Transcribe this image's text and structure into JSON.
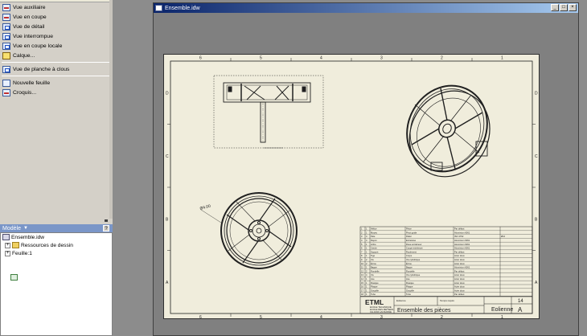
{
  "tools": [
    {
      "label": "Vue auxiliaire",
      "icon": "auxiliary-view-icon"
    },
    {
      "label": "Vue en coupe",
      "icon": "section-view-icon"
    },
    {
      "label": "Vue de détail",
      "icon": "detail-view-icon"
    },
    {
      "label": "Vue interrompue",
      "icon": "broken-view-icon"
    },
    {
      "label": "Vue en coupe locale",
      "icon": "local-section-icon"
    },
    {
      "label": "Calque...",
      "icon": "overlay-icon"
    },
    {
      "label": "Vue de planche à clous",
      "icon": "nailboard-view-icon"
    },
    {
      "label": "Nouvelle feuille",
      "icon": "new-sheet-icon"
    },
    {
      "label": "Croquis...",
      "icon": "sketch-icon"
    }
  ],
  "model_panel": {
    "title": "Modèle",
    "help": "?",
    "tree": [
      {
        "label": "Ensemble.idw",
        "icon": "drawing-icon",
        "expand": ""
      },
      {
        "label": "Ressources de dessin",
        "icon": "folder-icon",
        "expand": "+"
      },
      {
        "label": "Feuille:1",
        "icon": "sheet-icon",
        "expand": "+"
      }
    ]
  },
  "document": {
    "title": "Ensemble.idw",
    "buttons": {
      "minimize": "_",
      "maximize": "□",
      "close": "×"
    }
  },
  "sheet": {
    "col_labels": [
      "6",
      "5",
      "4",
      "3",
      "2",
      "1"
    ],
    "row_labels": [
      "D",
      "C",
      "B",
      "A"
    ],
    "dimension_label": "Ø4.00",
    "title_block": {
      "school_logo": "ETML",
      "school_lines": [
        "ECOLE TECHNIQUE",
        "ECOLE DES METIERS",
        "CH-1004 LAUSANNE"
      ],
      "drawing_title": "Ensemble des pièces",
      "project": "Eolienne",
      "revision": "A",
      "sheet_number": "14",
      "author_label": "Eolienne",
      "date_label": "Temps requis"
    },
    "bom": [
      [
        "1",
        "1",
        "Hélice",
        "Pièce",
        "Par défaut",
        ""
      ],
      [
        "2",
        "1",
        "Moyeu",
        "Pivot guide",
        "Aluminium 6061",
        ""
      ],
      [
        "3",
        "4",
        "Pale",
        "Palier",
        "ISO 4762",
        "Ø10"
      ],
      [
        "4",
        "4",
        "Rayon",
        "Entretoise",
        "Aluminium 6061",
        ""
      ],
      [
        "5",
        "1",
        "Arbre",
        "Roue entraîneur",
        "Aluminium 6061",
        ""
      ],
      [
        "6",
        "1",
        "Cercle",
        "Coupe extérieure",
        "Aluminium 6061",
        ""
      ],
      [
        "7",
        "1",
        "Support",
        "Roulement",
        "Par défaut",
        ""
      ],
      [
        "8",
        "1",
        "Tige",
        "Corps",
        "Acier doux",
        ""
      ],
      [
        "9",
        "2",
        "Vis",
        "Vis cylindrique",
        "Acier doux",
        ""
      ],
      [
        "10",
        "2",
        "Écrou",
        "Écrou",
        "Acier doux",
        ""
      ],
      [
        "11",
        "1",
        "Bague",
        "Bague",
        "Aluminium 6061",
        ""
      ],
      [
        "12",
        "2",
        "Rondelle",
        "Rondelle",
        "Par défaut",
        ""
      ],
      [
        "13",
        "4",
        "Vis",
        "Vis cylindrique",
        "Acier doux",
        ""
      ],
      [
        "14",
        "1",
        "Axe",
        "Axe",
        "Acier doux",
        ""
      ],
      [
        "15",
        "1",
        "Flasque",
        "Flasque",
        "Acier doux",
        ""
      ],
      [
        "16",
        "1",
        "Plaque",
        "Plaque",
        "Acier doux",
        ""
      ],
      [
        "17",
        "1",
        "Goupille",
        "Goupille",
        "Acier doux",
        ""
      ],
      [
        "18",
        "1",
        "Tube",
        "Tube",
        "Par défaut",
        ""
      ]
    ]
  }
}
